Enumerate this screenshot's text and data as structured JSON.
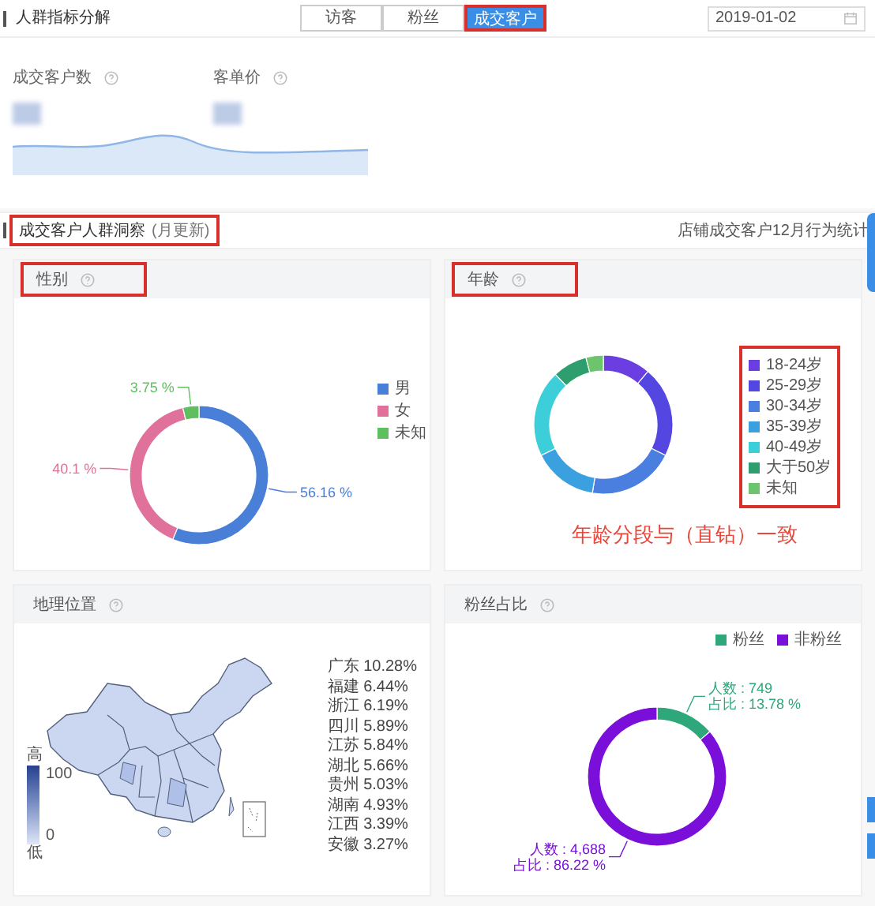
{
  "header": {
    "title": "人群指标分解",
    "date": "2019-01-02"
  },
  "tabs": [
    {
      "label": "访客",
      "selected": false,
      "highlighted": false
    },
    {
      "label": "粉丝",
      "selected": false,
      "highlighted": false
    },
    {
      "label": "成交客户",
      "selected": true,
      "highlighted": true
    }
  ],
  "metrics": [
    {
      "label": "成交客户数"
    },
    {
      "label": "客单价"
    }
  ],
  "section": {
    "title": "成交客户人群洞察",
    "note": "(月更新)",
    "highlighted": true,
    "right_text": "店铺成交客户12月行为统计"
  },
  "gender": {
    "title": "性别",
    "highlighted": true,
    "legend": [
      {
        "color": "#4a7fd8"
      },
      {
        "color": "#e0719a"
      },
      {
        "color": "#5fbf5f"
      }
    ],
    "slice_labels": [
      [
        "56.16 %"
      ],
      [
        "40.1 %"
      ],
      [
        "3.75 %"
      ]
    ],
    "chart_data": {
      "type": "donut",
      "categories": [
        "男",
        "女",
        "未知"
      ],
      "values": [
        56.16,
        40.1,
        3.75
      ]
    }
  },
  "age": {
    "title": "年龄",
    "highlighted": true,
    "legend_highlighted": true,
    "legend": [
      {
        "label": "18-24岁",
        "color": "#6a3ee0"
      },
      {
        "label": "25-29岁",
        "color": "#5446e0"
      },
      {
        "label": "30-34岁",
        "color": "#4a7fe0"
      },
      {
        "label": "35-39岁",
        "color": "#3aa0e0"
      },
      {
        "label": "40-49岁",
        "color": "#3ccfd9"
      },
      {
        "label": "大于50岁",
        "color": "#2e9e6e"
      },
      {
        "label": "未知",
        "color": "#6cc56c"
      }
    ],
    "caption": "年龄分段与（直钻）一致"
  },
  "geo": {
    "title": "地理位置",
    "scale_high": "高",
    "scale_low": "低",
    "scale_max": "100",
    "scale_min": "0",
    "provinces": [
      "广东 10.28%",
      "福建 6.44%",
      "浙江 6.19%",
      "四川 5.89%",
      "江苏 5.84%",
      "湖北 5.66%",
      "贵州 5.03%",
      "湖南 4.93%",
      "江西 3.39%",
      "安徽 3.27%"
    ]
  },
  "fans": {
    "title": "粉丝占比",
    "legend": [
      {
        "color": "#2ea77a"
      },
      {
        "color": "#7a0fd9"
      }
    ],
    "slice_labels": [
      [
        "人数 : 749",
        "占比 : 13.78 %"
      ],
      [
        "人数 : 4,688",
        "占比 : 86.22 %"
      ]
    ],
    "chart_data": {
      "type": "donut",
      "categories": [
        "粉丝",
        "非粉丝"
      ],
      "values": [
        13.78,
        86.22
      ]
    }
  }
}
